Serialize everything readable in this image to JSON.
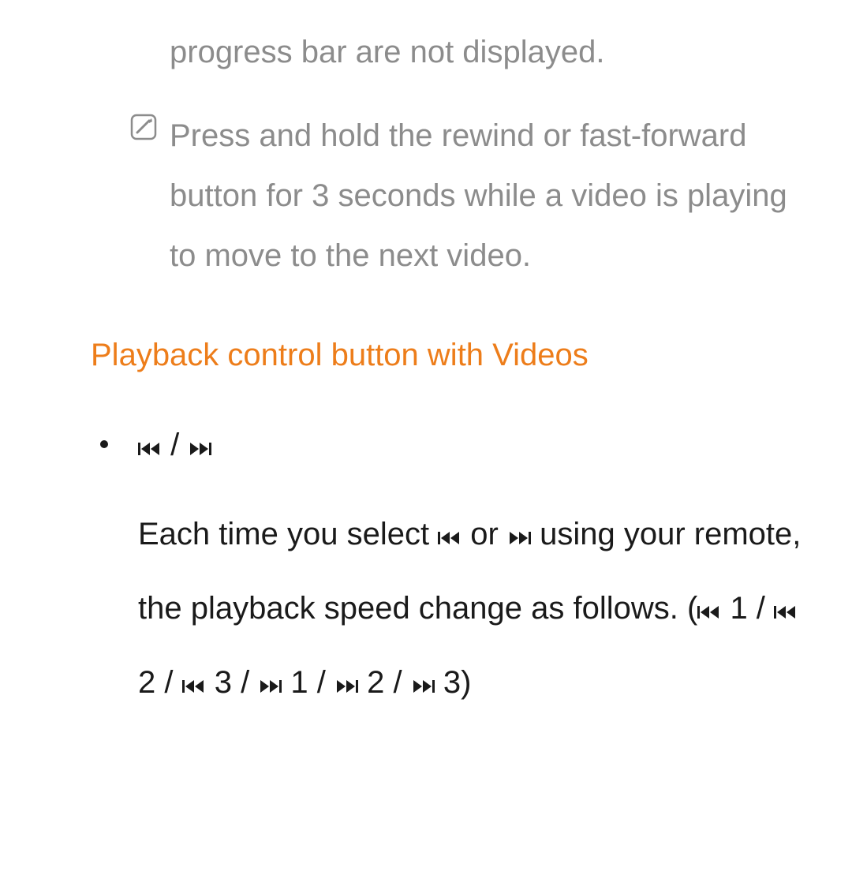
{
  "fragment_line": "progress bar are not displayed.",
  "note_text": "Press and hold the rewind or fast-forward button for 3 seconds while a video is playing to move to the next video.",
  "heading": "Playback control button with Videos",
  "bullet_symbols_text": " / ",
  "body": {
    "p1a": "Each time you select ",
    "p1b": " or ",
    "p1c": " using your remote, the playback speed change as follows. (",
    "seq1": " 1 / ",
    "seq2": " 2 / ",
    "seq3": " 3 / ",
    "seq4": " 1 / ",
    "seq5": " 2 / ",
    "seq6": " 3)"
  }
}
